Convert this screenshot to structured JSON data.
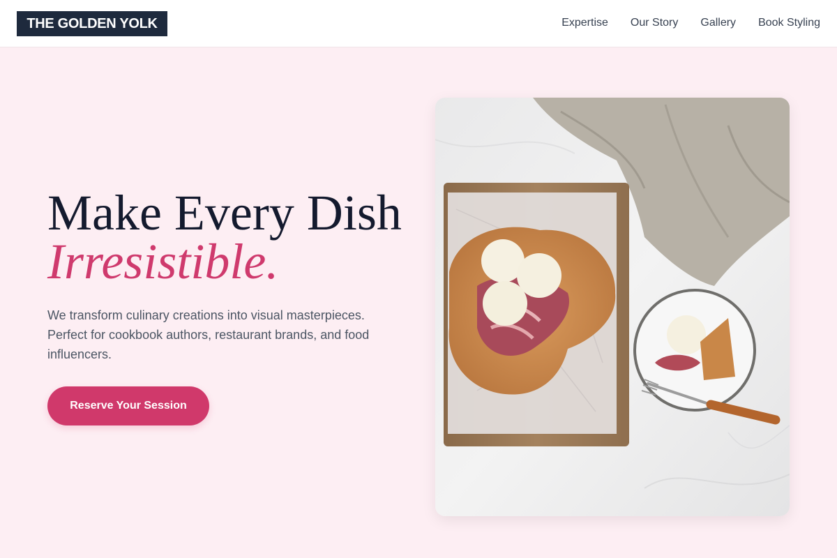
{
  "brand": {
    "name": "THE GOLDEN YOLK"
  },
  "nav": {
    "items": [
      {
        "label": "Expertise"
      },
      {
        "label": "Our Story"
      },
      {
        "label": "Gallery"
      },
      {
        "label": "Book Styling"
      }
    ]
  },
  "hero": {
    "title_line1": "Make Every Dish",
    "title_line2": "Irresistible.",
    "description": "We transform culinary creations into visual masterpieces. Perfect for cookbook authors, restaurant brands, and food influencers.",
    "cta_label": "Reserve Your Session",
    "accent_color": "#d0396b"
  },
  "colors": {
    "page_background": "#fdeef3",
    "header_background": "#ffffff",
    "logo_background": "#1e2a3d",
    "title_color": "#141a2e"
  }
}
